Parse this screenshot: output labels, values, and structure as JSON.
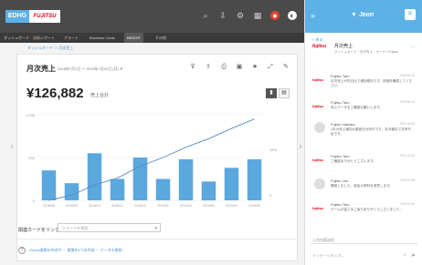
{
  "brand": {
    "logo_left": "EDHG",
    "logo_right": "FUJITSU"
  },
  "topbar": {
    "icons": [
      "search-icon",
      "download-icon",
      "gear-icon",
      "grid-icon",
      "user-icon",
      "logout-icon"
    ]
  },
  "nav": [
    {
      "label": "ダッシュボード"
    },
    {
      "label": "分析レポート"
    },
    {
      "label": "アラート"
    },
    {
      "label": "Business Cards"
    },
    {
      "label": "BRIGHT",
      "active": true
    },
    {
      "label": "その他"
    }
  ],
  "breadcrumb": "ダッシュボード ＞ 月次売上",
  "card": {
    "title": "月次売上",
    "period": "2018年7月1日 〜 2019年7月31日 (月) ▼",
    "amount": "¥126,882",
    "amount_unit": "売上合計",
    "tools": [
      "filter-icon",
      "export-icon",
      "share-icon",
      "print-icon",
      "star-icon",
      "expand-icon",
      "settings-icon"
    ]
  },
  "chart_data": {
    "type": "bar",
    "categories": [
      "1",
      "2",
      "3",
      "4",
      "5",
      "6",
      "7",
      "8",
      "9",
      "10"
    ],
    "series": [
      {
        "type": "bar",
        "values": [
          35,
          20,
          55,
          25,
          50,
          25,
          48,
          22,
          38,
          48
        ]
      },
      {
        "type": "line",
        "values": [
          0,
          6,
          18,
          26,
          40,
          50,
          62,
          72,
          84,
          95
        ]
      }
    ],
    "y_labels_left": [
      "1,000",
      "500",
      "0"
    ],
    "y_labels_right": [
      "25%",
      "0"
    ],
    "x_labels": [
      "2018/08",
      "2018/09",
      "2018/10",
      "2018/11",
      "2018/12",
      "2019/01",
      "2019/02",
      "2019/03",
      "2019/04",
      "2019/05"
    ],
    "ylim": [
      0,
      100
    ],
    "colors": {
      "bar": "#5aa8de",
      "line": "#5a8ac8"
    }
  },
  "related": {
    "label": "関連カードをリンク",
    "placeholder": "Q カードを検索..."
  },
  "footer": {
    "links": "Zeens連携を作成中 ・ 連携先4つの作成 ・ データの更新"
  },
  "panel": {
    "brand": "Jeon",
    "back": "< 戻る",
    "thread_title": "月次売上",
    "thread_sub": "ダッシュボード・月次売上・オーナーFujitsu",
    "messages": [
      {
        "name": "Fujitsu Taro",
        "time": "7/03 09:12",
        "text": "月次売上が先月比で増加傾向です。詳細を確認してください。"
      },
      {
        "name": "Fujitsu Taro",
        "time": "7/03 09:14",
        "text": "売上データをご確認お願いします。"
      },
      {
        "name": "Fujitsu Hanako",
        "time": "7/03 10:02",
        "text": "1月の売上増加の要因を分析中です。月次報告で共有予定です。"
      },
      {
        "name": "Fujitsu Taro",
        "time": "7/03 10:20",
        "text": "ご確認ありがとうございます。"
      },
      {
        "name": "Fujitsu Jiro",
        "time": "7/03 11:05",
        "text": "確認しました。追加の資料を用意します。"
      },
      {
        "name": "Fujitsu Taro",
        "time": "7/03 11:30",
        "text": "チームの皆さまご協力ありがとうございました。"
      }
    ],
    "input_label": "入力内容送信",
    "input_placeholder": "メッセージを入力..."
  }
}
